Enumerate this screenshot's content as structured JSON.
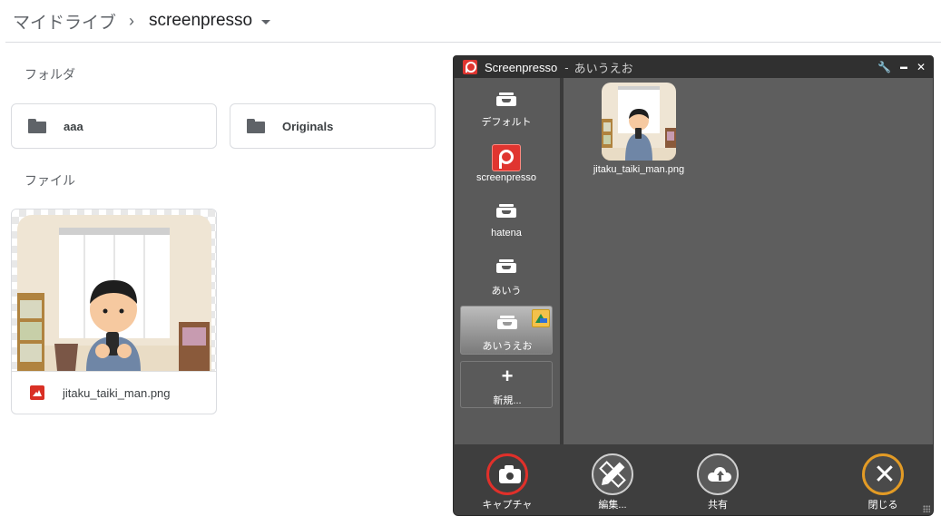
{
  "breadcrumb": {
    "root": "マイドライブ",
    "separator": "›",
    "current": "screenpresso"
  },
  "drive": {
    "folders_heading": "フォルダ",
    "folders": [
      {
        "name": "aaa",
        "icon": "folder-icon"
      },
      {
        "name": "Originals",
        "icon": "folder-icon"
      }
    ],
    "files_heading": "ファイル",
    "files": [
      {
        "name": "jitaku_taiki_man.png",
        "icon": "image-icon"
      }
    ]
  },
  "screenpresso": {
    "app_name": "Screenpresso",
    "title_separator": "-",
    "title_folder": "あいうえお",
    "controls": {
      "settings": "🔧",
      "minimize": "▬",
      "close": "✕"
    },
    "sidebar": [
      {
        "label": "デフォルト",
        "icon": "tray-icon"
      },
      {
        "label": "screenpresso",
        "icon": "screenpresso-icon"
      },
      {
        "label": "hatena",
        "icon": "tray-icon"
      },
      {
        "label": "あいう",
        "icon": "tray-icon"
      },
      {
        "label": "あいうえお",
        "icon": "tray-icon",
        "selected": true,
        "badge": "google-drive-icon"
      }
    ],
    "new_label": "新規...",
    "thumbnail_label": "jitaku_taiki_man.png",
    "toolbar": {
      "capture": "キャプチャ",
      "edit": "編集...",
      "share": "共有",
      "close": "閉じる"
    }
  },
  "colors": {
    "drive_border": "#dadce0",
    "drive_text": "#5f6368",
    "sp_dark": "#3d3d3d",
    "sp_panel": "#5a5a5a",
    "capture_red": "#e0302a",
    "close_orange": "#e39b25",
    "image_icon_red": "#d93025"
  }
}
